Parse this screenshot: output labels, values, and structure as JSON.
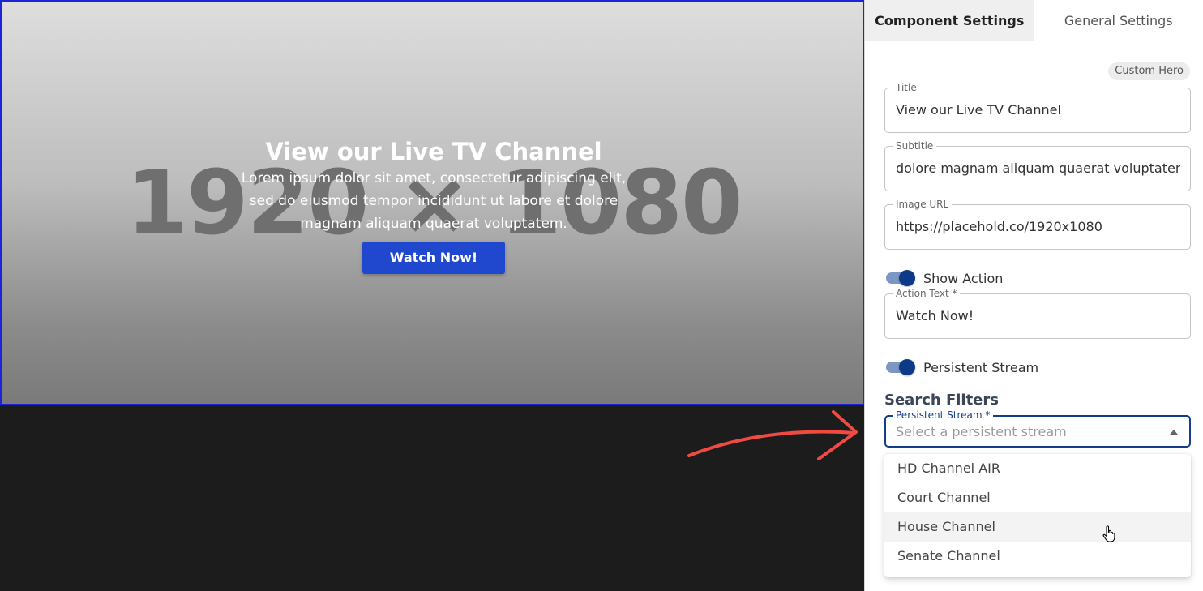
{
  "preview": {
    "placeholder_text": "1920 × 1080",
    "title": "View our Live TV Channel",
    "subtitle": "Lorem ipsum dolor sit amet, consectetur adipiscing elit, sed do eiusmod tempor incididunt ut labore et dolore magnam aliquam quaerat voluptatem.",
    "action_label": "Watch Now!"
  },
  "tabs": [
    {
      "label": "Component Settings",
      "active": true
    },
    {
      "label": "General Settings",
      "active": false
    }
  ],
  "badge": "Custom Hero",
  "fields": {
    "title": {
      "label": "Title",
      "value": "View our Live TV Channel"
    },
    "subtitle": {
      "label": "Subtitle",
      "value": "dolore magnam aliquam quaerat voluptatem."
    },
    "image_url": {
      "label": "Image URL",
      "value": "https://placehold.co/1920x1080"
    },
    "action_text": {
      "label": "Action Text *",
      "value": "Watch Now!"
    }
  },
  "toggles": {
    "show_action": {
      "label": "Show Action",
      "on": true
    },
    "persistent_stream": {
      "label": "Persistent Stream",
      "on": true
    }
  },
  "search_filters": {
    "heading": "Search Filters",
    "select": {
      "label": "Persistent Stream *",
      "placeholder": "Select a persistent stream",
      "options": [
        "HD Channel AIR",
        "Court Channel",
        "House Channel",
        "Senate Channel"
      ],
      "hovered": "House Channel"
    }
  },
  "colors": {
    "accent": "#123e8c",
    "action_button": "#1f48cf",
    "hero_border": "#1d23d6",
    "arrow": "#f04a43"
  }
}
